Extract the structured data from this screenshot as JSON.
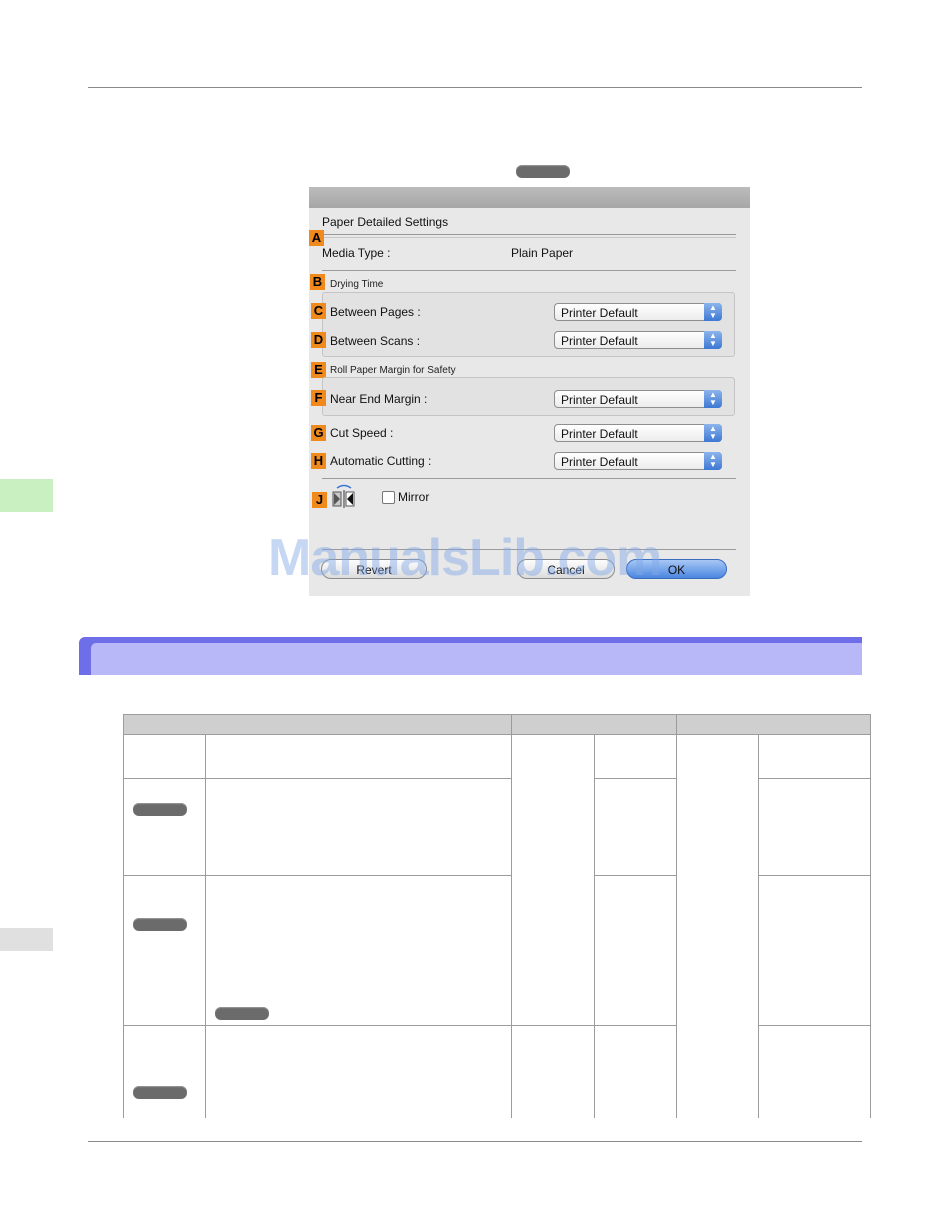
{
  "dialog": {
    "title": "Paper Detailed Settings",
    "media_type_label": "Media Type :",
    "media_type_value": "Plain Paper",
    "drying_time_label": "Drying Time",
    "between_pages_label": "Between Pages :",
    "between_pages_value": "Printer Default",
    "between_scans_label": "Between Scans :",
    "between_scans_value": "Printer Default",
    "roll_margin_label": "Roll Paper Margin for Safety",
    "near_end_label": "Near End Margin :",
    "near_end_value": "Printer Default",
    "cut_speed_label": "Cut Speed :",
    "cut_speed_value": "Printer Default",
    "auto_cut_label": "Automatic Cutting :",
    "auto_cut_value": "Printer Default",
    "mirror_label": "Mirror",
    "revert_label": "Revert",
    "cancel_label": "Cancel",
    "ok_label": "OK"
  },
  "callouts": {
    "a": "A",
    "b": "B",
    "c": "C",
    "d": "D",
    "e": "E",
    "f": "F",
    "g": "G",
    "h": "H",
    "j": "J"
  },
  "watermark": "ManualsLib.com",
  "colors": {
    "callout_orange": "#f08a1c",
    "section_header": "#b8b8f8",
    "section_header_border": "#6e6ee8",
    "side_tab_green": "#c8f0c0"
  }
}
